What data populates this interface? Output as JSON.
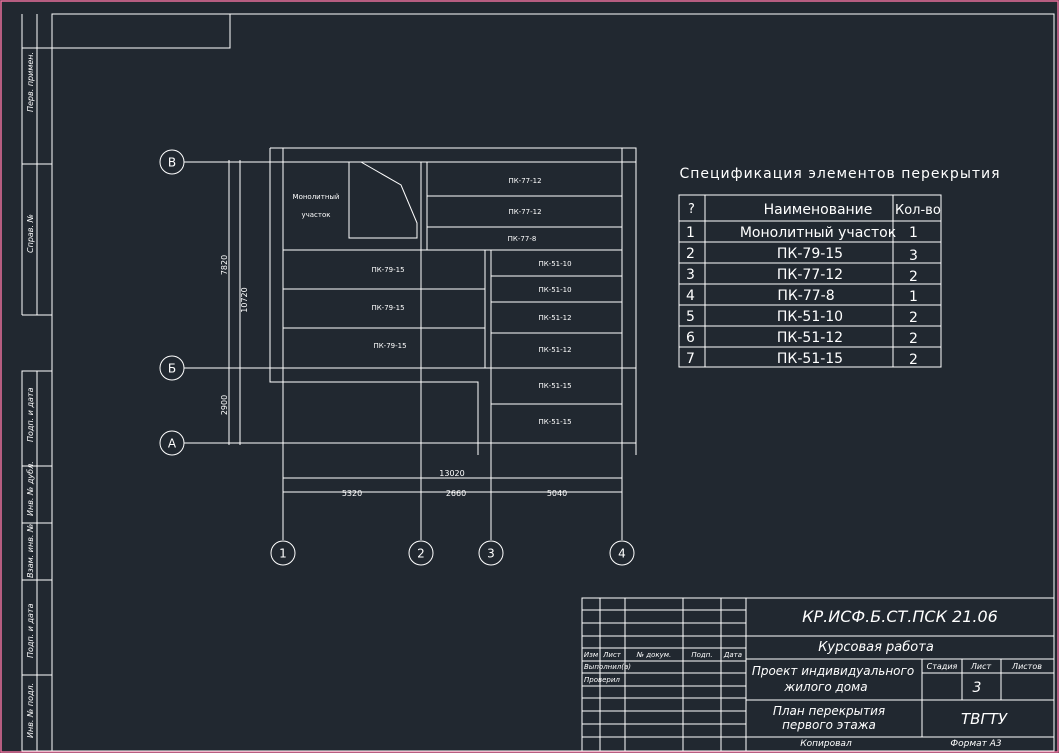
{
  "side_stamp": {
    "labels": [
      "Перв. примен.",
      "Справ. №",
      "Подп. и дата",
      "Инв. № дубл.",
      "Взам. инв. №",
      "Подп. и дата",
      "Инв. № подл."
    ]
  },
  "plan": {
    "axes_letters": [
      "В",
      "Б",
      "А"
    ],
    "axes_numbers": [
      "1",
      "2",
      "3",
      "4"
    ],
    "dimensions": {
      "total_height": "10720",
      "upper_height": "7820",
      "lower_height": "2900",
      "total_width": "13020",
      "span_1_2": "5320",
      "span_2_3": "2660",
      "span_3_4": "5040"
    },
    "monolithic_label_1": "Монолитный",
    "monolithic_label_2": "участок",
    "slabs": {
      "s1": "ПК-77-12",
      "s2": "ПК-77-12",
      "s3": "ПК-77-8",
      "s4": "ПК-79-15",
      "s5": "ПК-79-15",
      "s6": "ПК-79-15",
      "s7": "ПК-51-10",
      "s8": "ПК-51-10",
      "s9": "ПК-51-12",
      "s10": "ПК-51-12",
      "s11": "ПК-51-15",
      "s12": "ПК-51-15"
    }
  },
  "specification": {
    "title": "Спецификация элементов перекрытия",
    "headers": [
      "?",
      "Наименование",
      "Кол-во"
    ],
    "rows": [
      [
        "1",
        "Монолитный участок",
        "1"
      ],
      [
        "2",
        "ПК-79-15",
        "3"
      ],
      [
        "3",
        "ПК-77-12",
        "2"
      ],
      [
        "4",
        "ПК-77-8",
        "1"
      ],
      [
        "5",
        "ПК-51-10",
        "2"
      ],
      [
        "6",
        "ПК-51-12",
        "2"
      ],
      [
        "7",
        "ПК-51-15",
        "2"
      ]
    ]
  },
  "title_block": {
    "code": "КР.ИСФ.Б.СТ.ПСК 21.06",
    "work_type": "Курсовая работа",
    "project_line1": "Проект индивидуального",
    "project_line2": "жилого дома",
    "sheet_title_line1": "План перекрытия",
    "sheet_title_line2": "первого этажа",
    "org": "ТВГТУ",
    "stage_label": "Стадия",
    "sheet_label": "Лист",
    "sheets_label": "Листов",
    "sheet_number": "3",
    "col_izm": "Изм",
    "col_list": "Лист",
    "col_doc": "№ докум.",
    "col_sign": "Подп.",
    "col_date": "Дата",
    "row_executed": "Выполнил(а)",
    "row_checked": "Проверил",
    "copied": "Копировал",
    "format": "Формат А3"
  },
  "colors": {
    "background": "#212830",
    "lines": "#ffffff",
    "outer_frame": "#e86f9a"
  }
}
